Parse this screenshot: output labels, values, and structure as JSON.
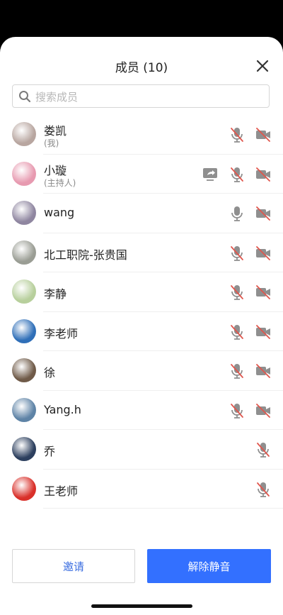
{
  "header": {
    "title": "成员 (10)"
  },
  "search": {
    "placeholder": "搜索成员"
  },
  "members": [
    {
      "name": "娄凯",
      "sub": "(我)",
      "mic": "muted",
      "video": "off",
      "share": false,
      "avatar": "#b8a6a0"
    },
    {
      "name": "小璇",
      "sub": "(主持人)",
      "mic": "muted",
      "video": "off",
      "share": true,
      "avatar": "#e79ab0"
    },
    {
      "name": "wang",
      "sub": "",
      "mic": "on",
      "video": "off",
      "share": false,
      "avatar": "#8f86a0"
    },
    {
      "name": "北工职院-张贵国",
      "sub": "",
      "mic": "muted",
      "video": "off",
      "share": false,
      "avatar": "#9a9d94"
    },
    {
      "name": "李静",
      "sub": "",
      "mic": "muted",
      "video": "off",
      "share": false,
      "avatar": "#b7cf9c"
    },
    {
      "name": "李老师",
      "sub": "",
      "mic": "muted",
      "video": "off",
      "share": false,
      "avatar": "#2f6fb8"
    },
    {
      "name": "徐",
      "sub": "",
      "mic": "muted",
      "video": "off",
      "share": false,
      "avatar": "#6f5a48"
    },
    {
      "name": "Yang.h",
      "sub": "",
      "mic": "muted",
      "video": "off",
      "share": false,
      "avatar": "#5e83a6"
    },
    {
      "name": "乔",
      "sub": "",
      "mic": "muted",
      "video": null,
      "share": false,
      "avatar": "#2c3f5e"
    },
    {
      "name": "王老师",
      "sub": "",
      "mic": "muted",
      "video": null,
      "share": false,
      "avatar": "#d9302a"
    }
  ],
  "footer": {
    "invite_label": "邀请",
    "unmute_all_label": "解除静音"
  },
  "colors": {
    "accent": "#3370ff",
    "muted_slash": "#e0564d"
  }
}
